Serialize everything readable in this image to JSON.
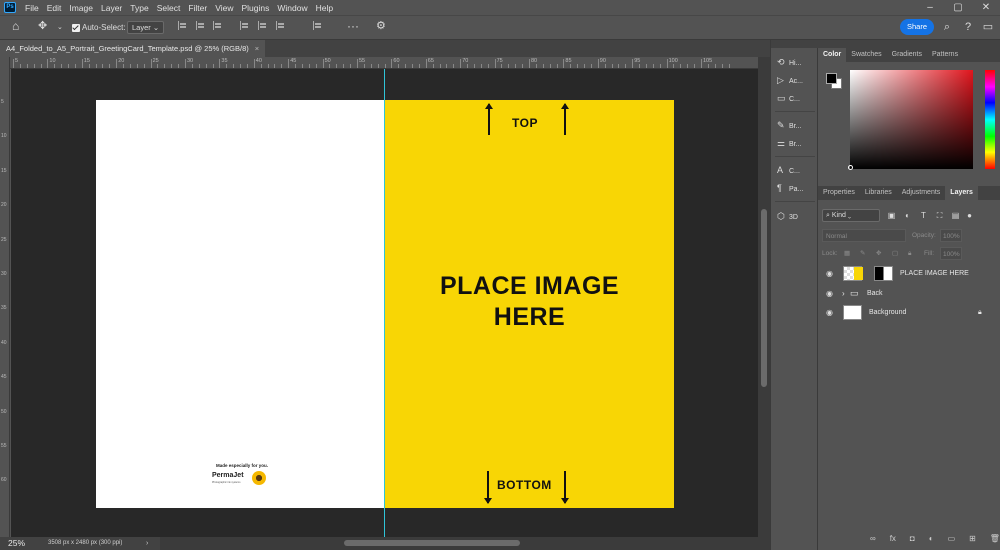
{
  "menu": {
    "logo": "Ps",
    "items": [
      "File",
      "Edit",
      "Image",
      "Layer",
      "Type",
      "Select",
      "Filter",
      "View",
      "Plugins",
      "Window",
      "Help"
    ]
  },
  "options": {
    "auto_select_label": "Auto-Select:",
    "auto_select_value": "Layer",
    "share_label": "Share"
  },
  "document": {
    "tab_title": "A4_Folded_to_A5_Portrait_GreetingCard_Template.psd @ 25% (RGB/8)",
    "tab_close": "×"
  },
  "rulers": {
    "h_labels": [
      "5",
      "10",
      "15",
      "20",
      "25",
      "30",
      "35",
      "40",
      "45",
      "50",
      "55",
      "60",
      "65",
      "70",
      "75",
      "80",
      "85",
      "90",
      "95",
      "100",
      "105"
    ],
    "v_labels": [
      "5",
      "10",
      "15",
      "20",
      "25",
      "30",
      "35",
      "40",
      "45",
      "50",
      "55",
      "60"
    ]
  },
  "card": {
    "top_label": "TOP",
    "bottom_label": "BOTTOM",
    "place_line1": "PLACE IMAGE",
    "place_line2": "HERE",
    "made_text": "Made especially for you.",
    "brand": "PermaJet",
    "brand_sub": "Photographic ink systems"
  },
  "status": {
    "zoom": "25%",
    "doc_info": "3508 px x 2480 px (300 ppi)",
    "arrow": "›"
  },
  "panel_column": {
    "items": [
      "Hi...",
      "Ac...",
      "C...",
      "Br...",
      "Br...",
      "C...",
      "Pa...",
      "3D"
    ]
  },
  "color_panel": {
    "tabs": [
      "Color",
      "Swatches",
      "Gradients",
      "Patterns"
    ],
    "foreground": "#000000",
    "background": "#ffffff"
  },
  "layers_panel": {
    "tabs": [
      "Properties",
      "Libraries",
      "Adjustments",
      "Layers"
    ],
    "kind_label": "Kind",
    "blend_mode": "Normal",
    "opacity_label": "Opacity:",
    "opacity_value": "100%",
    "lock_label": "Lock:",
    "fill_label": "Fill:",
    "fill_value": "100%",
    "layers": [
      {
        "name": "PLACE IMAGE HERE"
      },
      {
        "name": "Back"
      },
      {
        "name": "Background"
      }
    ]
  },
  "colors": {
    "accent": "#1473e6",
    "card_yellow": "#f8d605",
    "guide": "#30c4d8"
  }
}
